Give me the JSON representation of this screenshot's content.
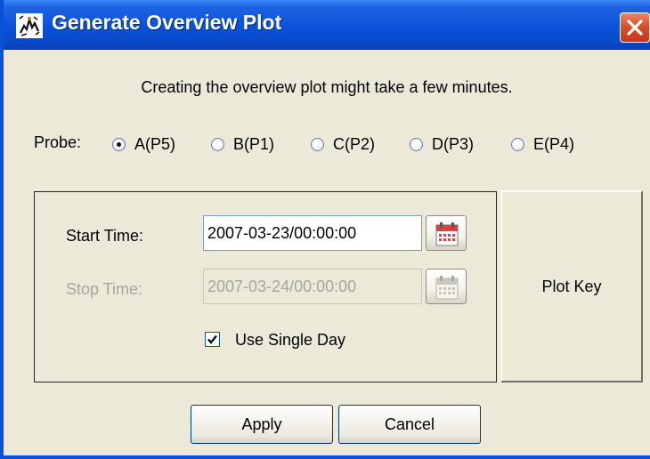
{
  "window": {
    "title": "Generate Overview Plot",
    "app_icon": "app-logo-icon",
    "close_icon": "close-icon",
    "title_bar_color": "#0a52d9"
  },
  "message": "Creating the overview plot might take a few minutes.",
  "probe": {
    "label": "Probe:",
    "options": [
      "A(P5)",
      "B(P1)",
      "C(P2)",
      "D(P3)",
      "E(P4)"
    ],
    "selected": "A(P5)"
  },
  "time": {
    "start_label": "Start Time:",
    "start_value": "2007-03-23/00:00:00",
    "stop_label": "Stop Time:",
    "stop_value": "2007-03-24/00:00:00",
    "stop_enabled": false,
    "calendar_icon": "calendar-icon"
  },
  "single_day": {
    "label": "Use Single Day",
    "checked": true
  },
  "buttons": {
    "plot_key": "Plot Key",
    "apply": "Apply",
    "cancel": "Cancel"
  }
}
